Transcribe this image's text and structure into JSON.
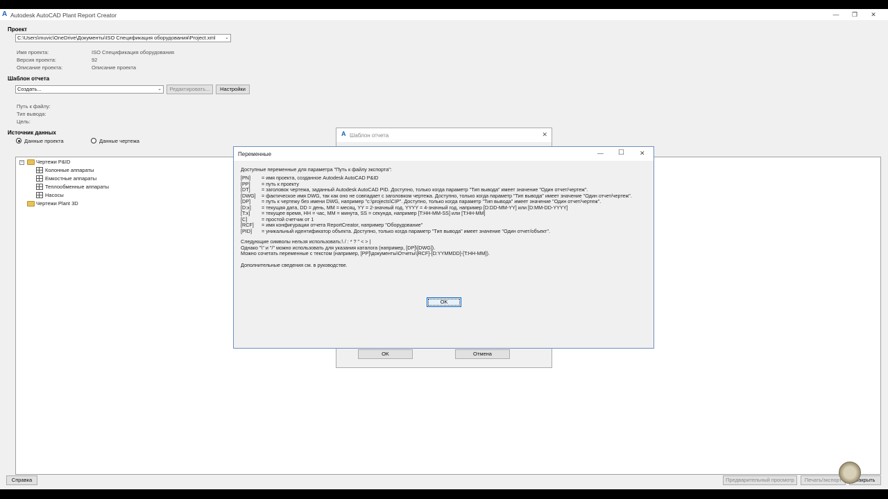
{
  "app": {
    "logo": "A",
    "title": "Autodesk AutoCAD Plant Report Creator",
    "win_min": "—",
    "win_max": "❐",
    "win_close": "✕"
  },
  "project": {
    "section": "Проект",
    "path": "C:\\Users\\muvic\\OneDrive\\Документы\\ISO Спецификация оборудования\\Project.xml",
    "name_label": "Имя проекта:",
    "name_value": "ISO Спецификация оборудования",
    "version_label": "Версия проекта:",
    "version_value": "92",
    "desc_label": "Описание проекта:",
    "desc_value": "Описание проекта"
  },
  "template": {
    "section": "Шаблон отчета",
    "selected": "Создать...",
    "edit_button": "Редактировать...",
    "settings_button": "Настройки",
    "file_path_label": "Путь к файлу:",
    "output_type_label": "Тип вывода:",
    "target_label": "Цель:"
  },
  "datasource": {
    "section": "Источник данных",
    "radio_project": "Данные проекта",
    "radio_drawing": "Данные чертежа",
    "selected": "project"
  },
  "tree": {
    "root1": {
      "expander": "−",
      "label": "Чертежи P&ID"
    },
    "children": [
      "Колонные аппараты",
      "Емкостные аппараты",
      "Теплообменные аппараты",
      "Насосы"
    ],
    "root2": {
      "label": "Чертежи Plant 3D"
    }
  },
  "back_dialog": {
    "logo": "A",
    "title": "Шаблон отчета",
    "close": "✕",
    "ok": "OK",
    "cancel": "Отмена"
  },
  "dialog": {
    "title": "Переменные",
    "min": "—",
    "max": "☐",
    "close": "✕",
    "intro": "Доступные переменные для параметра \"Путь к файлу экспорта\":",
    "vars": [
      {
        "code": "[PN]",
        "desc": "= имя проекта, созданное Autodesk AutoCAD P&ID"
      },
      {
        "code": "[PP]",
        "desc": "= путь к проекту"
      },
      {
        "code": "[DT]",
        "desc": "= заголовок чертежа, заданный Autodesk AutoCAD PID. Доступно, только когда параметр \"Тип вывода\" имеет значение \"Один отчет/чертеж\"."
      },
      {
        "code": "[DWG]",
        "desc": "= фактическое имя DWG, так как оно не совпадает с заголовком чертежа. Доступно, только когда параметр \"Тип вывода\" имеет значение \"Один отчет/чертеж\"."
      },
      {
        "code": "[DP]",
        "desc": "= путь к чертежу без имени DWG, например \"c:\\projects\\CIP\". Доступно, только когда параметр \"Тип вывода\" имеет значение \"Один отчет/чертеж\"."
      },
      {
        "code": "[D:x]",
        "desc": "= текущая дата, DD = день, MM = месяц, YY = 2-значный год, YYYY = 4-значный год, например [D:DD-MM-YY] или [D:MM-DD-YYYY]"
      },
      {
        "code": "[T:x]",
        "desc": "= текущее время, HH = час, MM = минута, SS = секунда, например [T:HH-MM-SS] или [T:HH-MM]"
      },
      {
        "code": "[C]",
        "desc": "= простой счетчик от 1"
      },
      {
        "code": "[RCF]",
        "desc": "= имя конфигурации отчета ReportCreator, например \"Оборудование\""
      },
      {
        "code": "[PID]",
        "desc": "= уникальный идентификатор объекта. Доступно, только когда параметр \"Тип вывода\" имеет значение \"Один отчет/объект\"."
      }
    ],
    "note1": "Следующие символы нельзя использовать:\\ / : * ? \" < > |",
    "note2": "Однако \"\\\" и \"/\" можно использовать для указания каталога (например, [DP]\\[DWG]).",
    "note3": "Можно сочетать переменные с текстом (например, [PP]\\документы\\Отчеты\\[RCF]-[D:YYMMDD]-[T:HH-MM]).",
    "note4": "Дополнительные сведения см. в руководстве.",
    "ok": "OK"
  },
  "footer": {
    "help": "Справка",
    "preview": "Предварительный просмотр",
    "print_export": "Печать/экспорт",
    "close": "Закрыть"
  }
}
